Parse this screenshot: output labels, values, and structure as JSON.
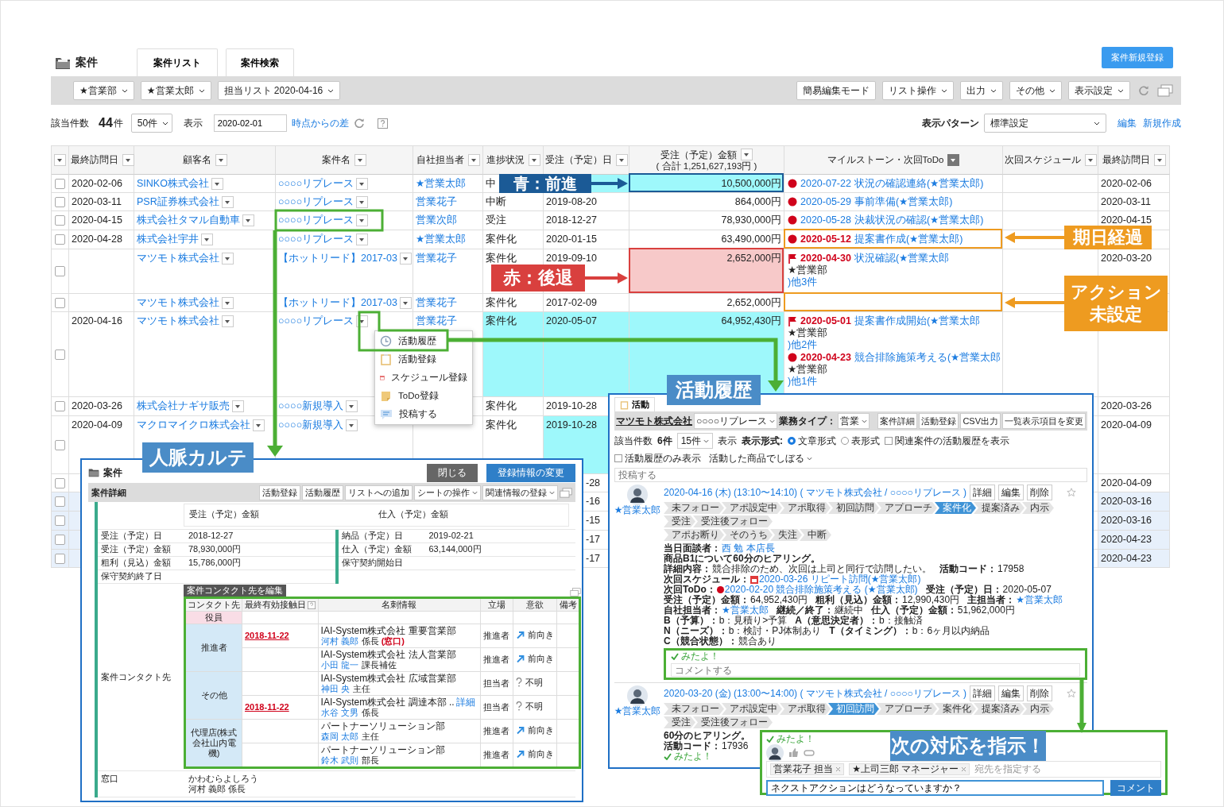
{
  "header": {
    "title": "案件",
    "tabs": [
      "案件リスト",
      "案件検索"
    ],
    "new_button": "案件新規登録"
  },
  "toolbar": {
    "filters": [
      "★営業部",
      "★営業太郎",
      "担当リスト 2020-04-16"
    ],
    "buttons": [
      {
        "label": "簡易編集モード",
        "dropdown": false
      },
      {
        "label": "リスト操作",
        "dropdown": true
      },
      {
        "label": "出力",
        "dropdown": true
      },
      {
        "label": "その他",
        "dropdown": true
      },
      {
        "label": "表示設定",
        "dropdown": true
      }
    ]
  },
  "summary": {
    "count_label": "該当件数",
    "count": "44",
    "count_unit": "件",
    "page_size": "50件",
    "view_label": "表示",
    "date": "2020-02-01",
    "diff_link": "時点からの差",
    "pattern_label": "表示パターン",
    "pattern": "標準設定",
    "links": [
      "編集",
      "新規作成"
    ]
  },
  "table": {
    "columns": [
      {
        "label": "最終訪問日",
        "filtered": false
      },
      {
        "label": "顧客名",
        "filtered": false
      },
      {
        "label": "案件名",
        "filtered": false
      },
      {
        "label": "自社担当者",
        "filtered": false
      },
      {
        "label": "進捗状況",
        "filtered": false
      },
      {
        "label": "受注（予定）日",
        "filtered": false
      },
      {
        "label": "受注（予定）金額",
        "note": "( 合計 1,251,627,193円 )",
        "filtered": false
      },
      {
        "label": "マイルストーン・次回ToDo",
        "filtered": true
      },
      {
        "label": "次回スケジュール",
        "filtered": false
      },
      {
        "label": "最終訪問日",
        "filtered": false
      }
    ],
    "rows": [
      {
        "checked": false,
        "highlighted": false,
        "visit": "2020-02-06",
        "customer": "SINKO株式会社",
        "deal": "○○○○リプレース",
        "owner": "★営業太郎",
        "status": "中",
        "status_up": false,
        "date_up": true,
        "amount": "10,500,000円",
        "amount_up": true,
        "amount_down": false,
        "milestones": [
          {
            "kind": "dot",
            "date": "2020-07-22",
            "overdue": false,
            "title": "状況の確認連絡(★営業太郎)"
          }
        ],
        "last_visit": "2020-02-06"
      },
      {
        "checked": false,
        "highlighted": false,
        "visit": "2020-03-11",
        "customer": "PSR証券株式会社",
        "deal": "○○○○リプレース",
        "owner": "営業花子",
        "status": "中断",
        "status_up": false,
        "order_date": "2019-08-20",
        "date_up": false,
        "amount": "864,000円",
        "amount_up": false,
        "amount_down": false,
        "milestones": [
          {
            "kind": "dot",
            "date": "2020-05-29",
            "overdue": false,
            "title": "事前準備(★営業太郎)"
          }
        ],
        "last_visit": "2020-03-11"
      },
      {
        "checked": false,
        "highlighted": false,
        "visit": "2020-04-15",
        "customer": "株式会社タマル自動車",
        "deal": "○○○○リプレース",
        "owner": "営業次郎",
        "status": "受注",
        "status_up": false,
        "order_date": "2018-12-27",
        "date_up": false,
        "amount": "78,930,000円",
        "amount_up": false,
        "amount_down": false,
        "milestones": [
          {
            "kind": "dot",
            "date": "2020-05-28",
            "overdue": false,
            "title": "決裁状況の確認(★営業太郎)"
          }
        ],
        "last_visit": "2020-04-15"
      },
      {
        "checked": false,
        "highlighted": false,
        "visit": "2020-04-28",
        "customer": "株式会社宇井",
        "deal": "○○○○リプレース",
        "owner": "★営業太郎",
        "status": "案件化",
        "status_up": false,
        "order_date": "2020-01-15",
        "date_up": false,
        "amount": "63,490,000円",
        "amount_up": false,
        "amount_down": false,
        "milestones": [
          {
            "kind": "dot",
            "date": "2020-05-12",
            "overdue": true,
            "title": "提案書作成(★営業太郎)"
          }
        ]
      },
      {
        "checked": false,
        "highlighted": false,
        "customer": "マツモト株式会社",
        "deal": "【ホットリード】2017-03",
        "owner": "営業花子",
        "status": "案件化",
        "status_up": false,
        "order_date": "2019-09-10",
        "date_up": false,
        "amount": "2,652,000円",
        "amount_up": false,
        "amount_down": true,
        "milestones": [
          {
            "kind": "flag",
            "date": "2020-04-30",
            "overdue": true,
            "title": "状況確認(★営業太郎",
            "group": "★営業部",
            "more": ")他3件"
          }
        ],
        "last_visit": "2020-03-20"
      },
      {
        "checked": false,
        "highlighted": false,
        "customer": "マツモト株式会社",
        "deal": "【ホットリード】2017-03",
        "owner": "営業花子",
        "status": "案件化",
        "status_up": false,
        "order_date": "2017-02-09",
        "date_up": false,
        "amount": "2,652,000円",
        "amount_up": false,
        "amount_down": false
      },
      {
        "checked": false,
        "highlighted": false,
        "visit": "2020-04-16",
        "customer": "マツモト株式会社",
        "deal": "○○○○リプレース",
        "owner": "営業花子",
        "status": "案件化",
        "status_up": true,
        "order_date": "2020-05-07",
        "date_up": true,
        "amount": "64,952,430円",
        "amount_up": true,
        "amount_down": false,
        "milestones": [
          {
            "kind": "flag",
            "date": "2020-05-01",
            "overdue": true,
            "title": "提案書作成開始(★営業太郎",
            "group": "★営業部",
            "more": ")他2件"
          },
          {
            "kind": "dot",
            "date": "2020-04-23",
            "overdue": true,
            "title": "競合排除施策考える(★営業太郎",
            "group": "★営業部",
            "more": ")他1件"
          }
        ]
      },
      {
        "checked": false,
        "highlighted": false,
        "visit": "2020-03-26",
        "customer": "株式会社ナギサ販売",
        "deal": "○○○○新規導入",
        "status": "案件化",
        "status_up": false,
        "order_date": "2019-10-28",
        "date_up": false,
        "last_visit": "2020-03-26"
      },
      {
        "checked": false,
        "highlighted": false,
        "visit": "2020-04-09",
        "customer": "マクロマイクロ株式会社",
        "deal": "○○○○新規導入",
        "status": "案件化",
        "status_up": false,
        "order_date": "2019-10-28",
        "date_up": true,
        "last_visit": "2020-04-09"
      },
      {
        "checked": false,
        "highlighted": false,
        "order_date_tail": "-28",
        "date_up": false,
        "last_visit": "2020-04-09"
      },
      {
        "checked": false,
        "highlighted": true,
        "order_date_tail": "-16",
        "date_up": false,
        "last_visit": "2020-03-16"
      },
      {
        "checked": false,
        "highlighted": true,
        "order_date_tail": "-15",
        "date_up": false,
        "last_visit": "2020-03-16"
      },
      {
        "checked": false,
        "highlighted": true,
        "order_date_tail": "-17",
        "date_up": false,
        "last_visit": "2020-04-23"
      },
      {
        "checked": false,
        "highlighted": true,
        "order_date_tail": "-17",
        "date_up": false,
        "last_visit": "2020-04-23"
      }
    ]
  },
  "context_menu": {
    "items": [
      "活動履歴",
      "活動登録",
      "スケジュール登録",
      "ToDo登録",
      "投稿する"
    ]
  },
  "annotations": [
    {
      "text": "青：前進",
      "color": "#1b5a96"
    },
    {
      "text": "赤：後退",
      "color": "#d9403e"
    },
    {
      "text": "期日経過",
      "color": "#ee9b20"
    },
    {
      "text": "アクション未設定",
      "color": "#ee9b20"
    }
  ],
  "contact_sheet": {
    "label": "人脈カルテ",
    "title": "案件",
    "buttons": [
      {
        "label": "閉じる",
        "kind": "secondary"
      },
      {
        "label": "登録情報の変更",
        "kind": "primary"
      }
    ],
    "section": "案件詳細",
    "actions": [
      {
        "label": "活動登録",
        "dropdown": false
      },
      {
        "label": "活動履歴",
        "dropdown": false
      },
      {
        "label": "リストへの追加",
        "dropdown": false
      },
      {
        "label": "シートの操作",
        "dropdown": true
      },
      {
        "label": "関連情報の登録",
        "dropdown": true
      }
    ],
    "chart_labels": [
      "受注（予定）金額",
      "仕入（予定）金額"
    ],
    "fields_left": [
      {
        "label": "受注（予定）日",
        "value": "2018-12-27"
      },
      {
        "label": "受注（予定）金額",
        "value": "78,930,000円"
      },
      {
        "label": "粗利（見込）金額",
        "value": "15,786,000円"
      },
      {
        "label": "保守契約終了日"
      }
    ],
    "fields_right": [
      {
        "label": "納品（予定）日",
        "value": "2019-02-21"
      },
      {
        "label": "仕入（予定）金額",
        "value": "63,144,000円"
      },
      {
        "label": "保守契約開始日"
      }
    ],
    "contacts_label": "案件コンタクト先",
    "edit_button": "案件コンタクト先を編集",
    "contact_columns": [
      "コンタクト先",
      "最終有効接触日",
      "名刺情報",
      "立場",
      "意欲",
      "備考"
    ],
    "groups": [
      {
        "name": "役員",
        "color": "#f9dde6"
      },
      {
        "name": "推進者",
        "color": "#d4e9f7",
        "contacts": [
          {
            "last_contact": "2018-11-22",
            "company": "IAI-System株式会社 重要営業部",
            "name": "河村 義郎",
            "title": "係長",
            "tag": "(窓口)",
            "role": "推進者",
            "kind": "up",
            "motivation": "前向き"
          },
          {
            "company": "IAI-System株式会社 法人営業部",
            "name": "小田 龍一",
            "title": "課長補佐",
            "role": "推進者",
            "kind": "up",
            "motivation": "前向き"
          }
        ]
      },
      {
        "name": "その他",
        "color": "#d4e9f7",
        "contacts": [
          {
            "company": "IAI-System株式会社 広域営業部",
            "name": "神田 央",
            "title": "主任",
            "role": "担当者",
            "kind": "unknown",
            "motivation": "不明"
          },
          {
            "last_contact": "2018-11-22",
            "company": "IAI-System株式会社 調達本部 ..",
            "detail_link": "詳細",
            "name": "水谷 文男",
            "title": "係長",
            "role": "担当者",
            "kind": "unknown",
            "motivation": "不明"
          }
        ]
      },
      {
        "name": "代理店(株式会社山内電機)",
        "color": "#d4e9f7",
        "contacts": [
          {
            "company": "パートナーソリューション部",
            "name": "森岡 太郎",
            "title": "主任",
            "role": "推進者",
            "kind": "up",
            "motivation": "前向き"
          },
          {
            "company": "パートナーソリューション部",
            "name": "鈴木 武則",
            "title": "部長",
            "role": "推進者",
            "kind": "up",
            "motivation": "前向き"
          }
        ]
      }
    ],
    "window_label": "窓口",
    "window_kana": "かわむらよしろう",
    "window_name": "河村 義郎 係長"
  },
  "activity_history": {
    "label": "活動履歴",
    "tab": "活動",
    "company": "マツモト株式会社",
    "deal": "○○○○リプレース",
    "type_label": "業務タイプ：",
    "type": "営業",
    "buttons": [
      "案件詳細",
      "活動登録",
      "CSV出力",
      "一覧表示項目を変更"
    ],
    "count_label": "該当件数",
    "count": "6件",
    "page_size": "15件",
    "view_label": "表示",
    "format_label": "表示形式:",
    "formats": [
      {
        "label": "文章形式",
        "selected": true
      },
      {
        "label": "表形式",
        "selected": false
      }
    ],
    "options": [
      {
        "label": "関連案件の活動履歴を表示",
        "checked": false
      },
      {
        "label": "活動履歴のみ表示",
        "checked": false
      }
    ],
    "product_filter": "活動した商品でしぼる",
    "post_placeholder": "投稿する",
    "entries": [
      {
        "user": "★営業太郎",
        "header": "2020-04-16 (木) (13:10〜14:10) ( マツモト株式会社 / ○○○○リプレース )",
        "actions": [
          "詳細",
          "編集",
          "削除"
        ],
        "stages": [
          {
            "label": "未フォロー",
            "selected": false
          },
          {
            "label": "アポ設定中",
            "selected": false
          },
          {
            "label": "アポ取得",
            "selected": false
          },
          {
            "label": "初回訪問",
            "selected": false
          },
          {
            "label": "アプローチ",
            "selected": false
          },
          {
            "label": "案件化",
            "selected": true
          },
          {
            "label": "提案済み",
            "selected": false
          },
          {
            "label": "内示",
            "selected": false
          },
          {
            "label": "受注",
            "selected": false
          },
          {
            "label": "受注後フォロー",
            "selected": false
          }
        ],
        "closed_stages": [
          {
            "label": "アポお断り",
            "selected": false
          },
          {
            "label": "そのうち",
            "selected": false
          },
          {
            "label": "失注",
            "selected": false
          },
          {
            "label": "中断",
            "selected": false
          }
        ],
        "lines": [
          {
            "kind": "fields",
            "items": [
              {
                "label": "当日面談者：",
                "value": "西 勉 本店長",
                "kind": "link"
              }
            ]
          },
          {
            "kind": "heading",
            "text": "商品B1について60分のヒアリング。"
          },
          {
            "kind": "fields",
            "items": [
              {
                "label": "詳細内容：",
                "value": "競合排除のため、次回は上司と同行で訪問したい。",
                "kind": "text"
              }
            ]
          },
          {
            "kind": "fields",
            "items": [
              {
                "label": "活動コード：",
                "value": "17958",
                "kind": "text"
              },
              {
                "label": "次回スケジュール：",
                "value": "2020-03-26 リピート訪問(★営業太郎)",
                "kind": "schedule"
              },
              {
                "label": "次回ToDo：",
                "value": "2020-02-20 競合排除施策考える (★営業太郎)",
                "kind": "todo"
              }
            ]
          },
          {
            "kind": "fields",
            "items": [
              {
                "label": "受注（予定）日：",
                "value": "2020-05-07",
                "kind": "text"
              },
              {
                "label": "受注（予定）金額：",
                "value": "64,952,430円",
                "kind": "text"
              },
              {
                "label": "粗利（見込）金額：",
                "value": "12,990,430円",
                "kind": "text"
              },
              {
                "label": "主担当者：",
                "value": "★営業太郎",
                "kind": "link"
              }
            ]
          },
          {
            "kind": "fields",
            "items": [
              {
                "label": "自社担当者：",
                "value": "★営業太郎",
                "kind": "link"
              },
              {
                "label": "継続／終了：",
                "value": "継続中",
                "kind": "text"
              },
              {
                "label": "仕入（予定）金額：",
                "value": "51,962,000円",
                "kind": "text"
              },
              {
                "label": "B（予算）：",
                "value": "b：見積り>予算",
                "kind": "text"
              },
              {
                "label": "A（意思決定者）：",
                "value": "b：接触済",
                "kind": "text"
              }
            ]
          },
          {
            "kind": "fields",
            "items": [
              {
                "label": "N（ニーズ）：",
                "value": "b：検討・PJ体制あり",
                "kind": "text"
              },
              {
                "label": "T（タイミング）：",
                "value": "b：6ヶ月以内納品",
                "kind": "text"
              },
              {
                "label": "C（競合状態）：",
                "value": "競合あり",
                "kind": "text"
              }
            ]
          }
        ],
        "seen": "みたよ！",
        "comment_placeholder": "コメントする"
      },
      {
        "user": "★営業太郎",
        "header": "2020-03-20 (金) (13:00〜14:00) ( マツモト株式会社 / ○○○○リプレース )",
        "actions": [
          "詳細",
          "編集",
          "削除"
        ],
        "stages": [
          {
            "label": "未フォロー",
            "selected": false
          },
          {
            "label": "アポ設定中",
            "selected": false
          },
          {
            "label": "アポ取得",
            "selected": false
          },
          {
            "label": "初回訪問",
            "selected": true
          },
          {
            "label": "アプローチ",
            "selected": false
          },
          {
            "label": "案件化",
            "selected": false
          },
          {
            "label": "提案済み",
            "selected": false
          },
          {
            "label": "内示",
            "selected": false
          },
          {
            "label": "受注",
            "selected": false
          },
          {
            "label": "受注後フォロー",
            "selected": false
          }
        ],
        "lines": [
          {
            "kind": "heading",
            "text": "60分のヒアリング。"
          },
          {
            "kind": "fields",
            "items": [
              {
                "label": "活動コード：",
                "value": "17936",
                "kind": "text"
              }
            ]
          }
        ],
        "seen": "みたよ！"
      }
    ]
  },
  "reply_box": {
    "label": "次の対応を指示！",
    "seen": "みたよ！",
    "recipients": [
      "営業花子 担当",
      "★上司三郎 マネージャー"
    ],
    "recipient_placeholder": "宛先を指定する",
    "message": "ネクストアクションはどうなっていますか？",
    "button": "コメント"
  }
}
